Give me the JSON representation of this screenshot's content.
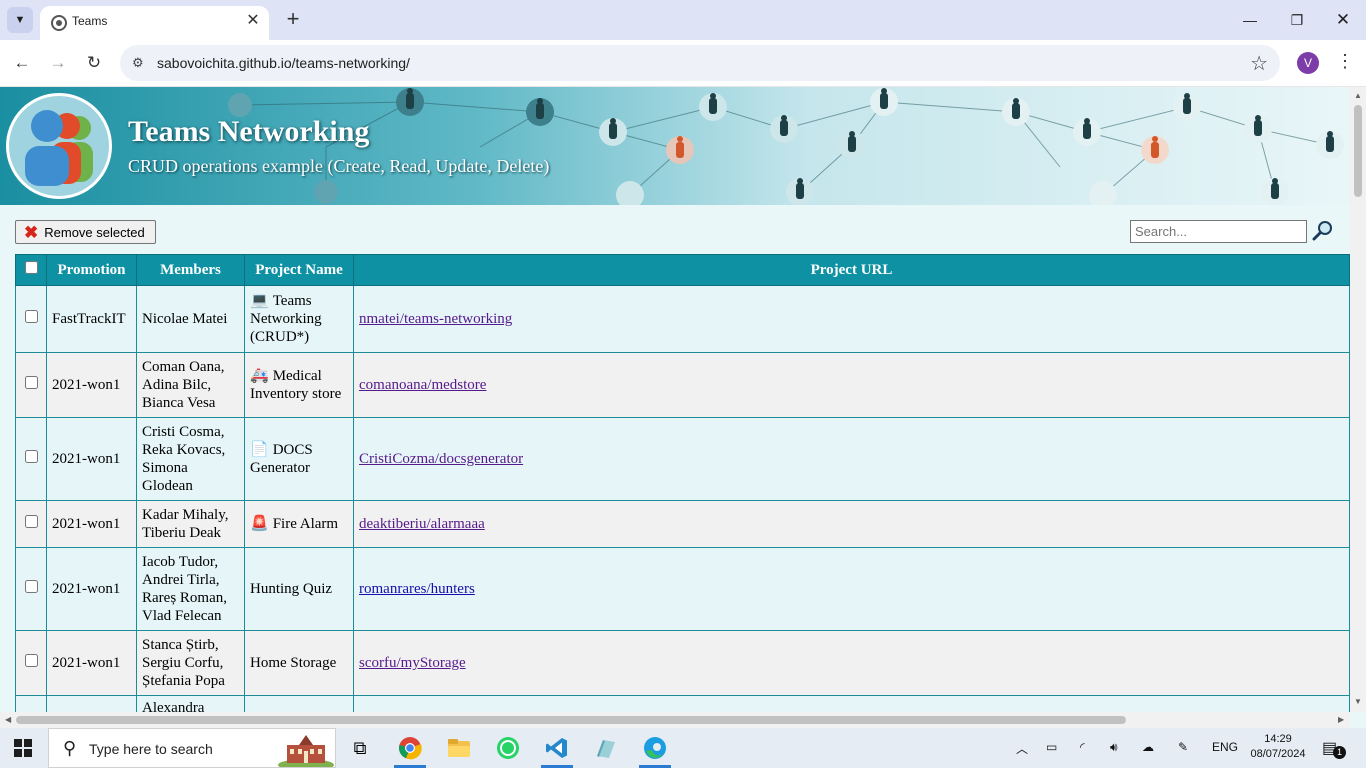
{
  "browser": {
    "tab_title": "Teams",
    "url": "sabovoichita.github.io/teams-networking/",
    "profile_initial": "V"
  },
  "page": {
    "title": "Teams Networking",
    "subtitle": "CRUD operations example (Create, Read, Update, Delete)",
    "remove_label": "Remove selected",
    "search_placeholder": "Search..."
  },
  "table": {
    "headers": [
      "Promotion",
      "Members",
      "Project Name",
      "Project URL"
    ],
    "rows": [
      {
        "promotion": "FastTrackIT",
        "members": "Nicolae Matei",
        "icon": "💻",
        "project": "Teams Networking (CRUD*)",
        "url": "nmatei/teams-networking"
      },
      {
        "promotion": "2021-won1",
        "members": "Coman Oana, Adina Bilc, Bianca Vesa",
        "icon": "🚑",
        "project": "Medical Inventory store",
        "url": "comanoana/medstore"
      },
      {
        "promotion": "2021-won1",
        "members": "Cristi Cosma, Reka Kovacs, Simona Glodean",
        "icon": "📄",
        "project": "DOCS Generator",
        "url": "CristiCozma/docsgenerator"
      },
      {
        "promotion": "2021-won1",
        "members": "Kadar Mihaly, Tiberiu Deak",
        "icon": "🚨",
        "project": "Fire Alarm",
        "url": "deaktiberiu/alarmaaa"
      },
      {
        "promotion": "2021-won1",
        "members": "Iacob Tudor, Andrei Tirla, Rareș Roman, Vlad Felecan",
        "icon": "",
        "project": "Hunting Quiz",
        "url": "romanrares/hunters"
      },
      {
        "promotion": "2021-won1",
        "members": "Stanca Știrb, Sergiu Corfu, Ștefania Popa",
        "icon": "",
        "project": "Home Storage",
        "url": "scorfu/myStorage"
      },
      {
        "promotion": "",
        "members": "Alexandra",
        "icon": "",
        "project": "",
        "url": ""
      }
    ]
  },
  "taskbar": {
    "search_placeholder": "Type here to search",
    "language": "ENG",
    "time": "14:29",
    "date": "08/07/2024",
    "notification_count": "1"
  }
}
